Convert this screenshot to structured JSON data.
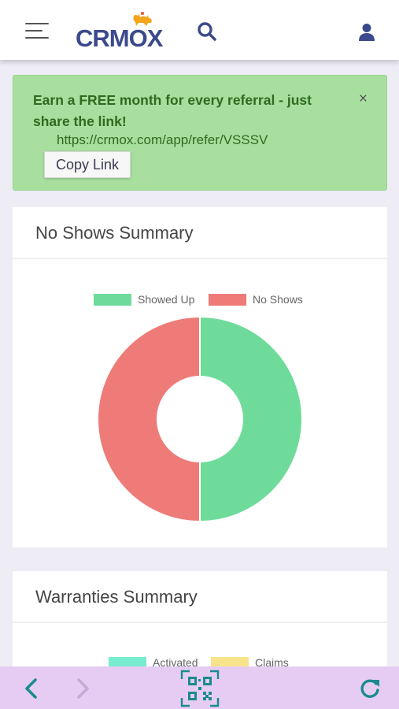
{
  "header": {
    "logo_text": "CRMOX",
    "menu_icon": "hamburger-menu-icon",
    "search_icon": "search-icon",
    "user_icon": "user-icon"
  },
  "referral_alert": {
    "message": "Earn a FREE month for every referral - just share the link!",
    "link": "https://crmox.com/app/refer/VSSSV",
    "copy_button": "Copy Link",
    "close_symbol": "×"
  },
  "no_shows_card": {
    "title": "No Shows Summary",
    "chart_data": {
      "type": "pie",
      "variant": "doughnut",
      "legend_position": "top",
      "series": [
        {
          "name": "Showed Up",
          "value": 50,
          "color": "#6fdb9a"
        },
        {
          "name": "No Shows",
          "value": 50,
          "color": "#ee7b78"
        }
      ]
    }
  },
  "warranties_card": {
    "title": "Warranties Summary",
    "legend": [
      {
        "name": "Activated",
        "color": "#77ecd0"
      },
      {
        "name": "Claims",
        "color": "#f7e48a"
      }
    ]
  },
  "bottom_nav": {
    "back_icon": "chevron-left-icon",
    "forward_icon": "chevron-right-icon",
    "qr_icon": "qr-code-icon",
    "refresh_icon": "refresh-icon",
    "accent_color": "#1a8b8f"
  }
}
